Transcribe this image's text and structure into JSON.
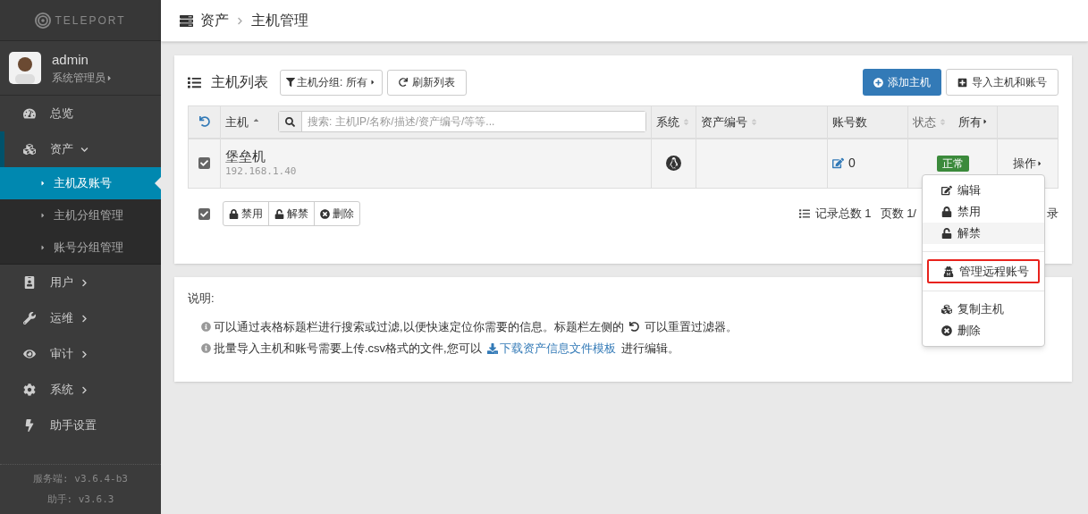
{
  "sidebar": {
    "logo": "TELEPORT",
    "user": {
      "name": "admin",
      "role": "系统管理员"
    },
    "items": [
      {
        "label": "总览",
        "expanded": false,
        "selected": false
      },
      {
        "label": "资产",
        "expanded": true,
        "selected": false,
        "children": [
          {
            "label": "主机及账号",
            "selected": true
          },
          {
            "label": "主机分组管理",
            "selected": false
          },
          {
            "label": "账号分组管理",
            "selected": false
          }
        ]
      },
      {
        "label": "用户",
        "expanded": false,
        "selected": false
      },
      {
        "label": "运维",
        "expanded": false,
        "selected": false
      },
      {
        "label": "审计",
        "expanded": false,
        "selected": false
      },
      {
        "label": "系统",
        "expanded": false,
        "selected": false
      },
      {
        "label": "助手设置",
        "expanded": false,
        "selected": false
      }
    ],
    "versions": [
      "服务端: v3.6.4-b3",
      "助手: v3.6.3"
    ]
  },
  "breadcrumb": [
    "资产",
    "主机管理"
  ],
  "host_list": {
    "title": "主机列表",
    "group_filter": "主机分组: 所有",
    "refresh_button": "刷新列表",
    "add_button": "添加主机",
    "import_button": "导入主机和账号",
    "columns": [
      {
        "label": "主机"
      },
      {
        "label": "系统"
      },
      {
        "label": "资产编号"
      },
      {
        "label": "账号数"
      },
      {
        "label": "状态",
        "filter": "所有"
      }
    ],
    "search_placeholder": "搜索: 主机IP/名称/描述/资产编号/等等...",
    "rows": [
      {
        "checked": true,
        "name": "堡垒机",
        "ip": "192.168.1.40",
        "accounts": "0",
        "status": "正常",
        "action": "操作"
      }
    ],
    "select_all_checked": true,
    "bulk_buttons": [
      "禁用",
      "解禁",
      "删除"
    ],
    "pagination": [
      "记录总数 1",
      "页数 1/",
      "录"
    ]
  },
  "action_menu": [
    {
      "kind": "item",
      "label": "编辑",
      "hovered": false,
      "outlined": false
    },
    {
      "kind": "item",
      "label": "禁用",
      "hovered": false,
      "outlined": false
    },
    {
      "kind": "item",
      "label": "解禁",
      "hovered": true,
      "outlined": false
    },
    {
      "kind": "divider"
    },
    {
      "kind": "item",
      "label": "管理远程账号",
      "hovered": false,
      "outlined": true
    },
    {
      "kind": "divider"
    },
    {
      "kind": "item",
      "label": "复制主机",
      "hovered": false,
      "outlined": false
    },
    {
      "kind": "item",
      "label": "删除",
      "hovered": false,
      "outlined": false
    }
  ],
  "notes": {
    "title": "说明:",
    "lines": [
      {
        "before": "可以通过表格标题栏进行搜索或过滤,以便快速定位你需要的信息。标题栏左侧的",
        "after": "可以重置过滤器。"
      },
      {
        "before": "批量导入主机和账号需要上传.csv格式的文件,您可以",
        "link": "下载资产信息文件模板",
        "after": "进行编辑。"
      }
    ]
  }
}
